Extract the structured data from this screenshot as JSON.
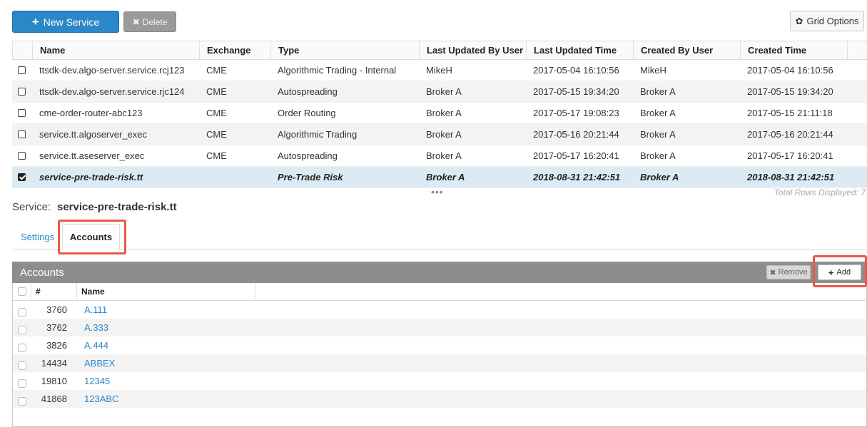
{
  "toolbar": {
    "new_service_label": "New Service",
    "delete_label": "Delete",
    "grid_options_label": "Grid Options"
  },
  "services": {
    "columns": [
      "Name",
      "Exchange",
      "Type",
      "Last Updated By User",
      "Last Updated Time",
      "Created By User",
      "Created Time"
    ],
    "rows": [
      [
        "ttsdk-dev.algo-server.service.rcj123",
        "CME",
        "Algorithmic Trading - Internal",
        "MikeH",
        "2017-05-04 16:10:56",
        "MikeH",
        "2017-05-04 16:10:56"
      ],
      [
        "ttsdk-dev.algo-server.service.rjc124",
        "CME",
        "Autospreading",
        "Broker A",
        "2017-05-15 19:34:20",
        "Broker A",
        "2017-05-15 19:34:20"
      ],
      [
        "cme-order-router-abc123",
        "CME",
        "Order Routing",
        "Broker A",
        "2017-05-17 19:08:23",
        "Broker A",
        "2017-05-15 21:11:18"
      ],
      [
        "service.tt.algoserver_exec",
        "CME",
        "Algorithmic Trading",
        "Broker A",
        "2017-05-16 20:21:44",
        "Broker A",
        "2017-05-16 20:21:44"
      ],
      [
        "service.tt.aseserver_exec",
        "CME",
        "Autospreading",
        "Broker A",
        "2017-05-17 16:20:41",
        "Broker A",
        "2017-05-17 16:20:41"
      ],
      [
        "service-pre-trade-risk.tt",
        "",
        "Pre-Trade Risk",
        "Broker A",
        "2018-08-31 21:42:51",
        "Broker A",
        "2018-08-31 21:42:51"
      ]
    ],
    "selected_index": 5,
    "more_indicator": "•••",
    "total_rows_text": "Total Rows Displayed: 7"
  },
  "service_detail": {
    "label": "Service:",
    "name": "service-pre-trade-risk.tt"
  },
  "tabs": [
    "Settings",
    "Accounts"
  ],
  "active_tab": "Accounts",
  "accounts": {
    "title": "Accounts",
    "remove_label": "Remove",
    "add_label": "Add",
    "columns": [
      "#",
      "Name"
    ],
    "rows": [
      [
        "3760",
        "A.111"
      ],
      [
        "3762",
        "A.333"
      ],
      [
        "3826",
        "A.444"
      ],
      [
        "14434",
        "ABBEX"
      ],
      [
        "19810",
        "12345"
      ],
      [
        "41868",
        "123ABC"
      ]
    ]
  },
  "colors": {
    "primary": "#2a87c8",
    "highlight": "#e8594a",
    "selected_row": "#dceaf3",
    "panel_header": "#8d8d8d"
  }
}
